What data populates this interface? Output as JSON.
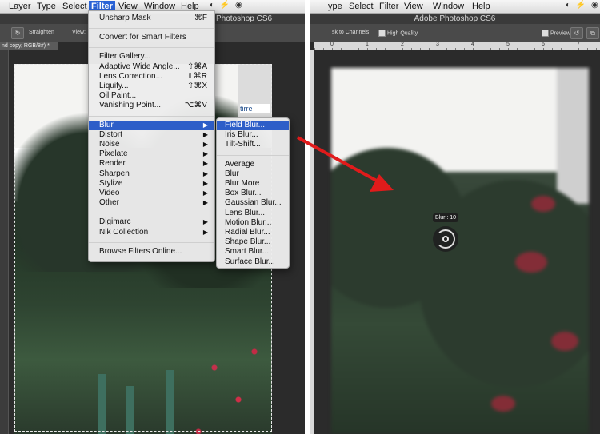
{
  "left": {
    "menubar": [
      "Layer",
      "Type",
      "Select",
      "Filter",
      "View",
      "Window",
      "Help"
    ],
    "active_menu": "Filter",
    "title": "Photoshop CS6",
    "options": {
      "straighten": "Straighten",
      "view": "View:"
    },
    "doc_tab": "nd copy, RGB/8#) *",
    "sign_text": "tirre"
  },
  "right": {
    "menubar": [
      "ype",
      "Select",
      "Filter",
      "View",
      "Window",
      "Help"
    ],
    "title": "Adobe Photoshop CS6",
    "options": {
      "channels": "sk to Channels",
      "high_quality": "High Quality",
      "preview": "Preview"
    },
    "ruler_ticks": [
      "0",
      "1",
      "2",
      "3",
      "4",
      "5",
      "6",
      "7"
    ],
    "blur_label": "Blur : 10"
  },
  "filter_menu": {
    "groups": [
      [
        {
          "label": "Unsharp Mask",
          "shortcut": "⌘F"
        }
      ],
      [
        {
          "label": "Convert for Smart Filters",
          "shortcut": ""
        }
      ],
      [
        {
          "label": "Filter Gallery...",
          "shortcut": ""
        },
        {
          "label": "Adaptive Wide Angle...",
          "shortcut": "⇧⌘A"
        },
        {
          "label": "Lens Correction...",
          "shortcut": "⇧⌘R"
        },
        {
          "label": "Liquify...",
          "shortcut": "⇧⌘X"
        },
        {
          "label": "Oil Paint...",
          "shortcut": ""
        },
        {
          "label": "Vanishing Point...",
          "shortcut": "⌥⌘V"
        }
      ],
      [
        {
          "label": "Blur",
          "submenu": true,
          "highlighted": true
        },
        {
          "label": "Distort",
          "submenu": true
        },
        {
          "label": "Noise",
          "submenu": true
        },
        {
          "label": "Pixelate",
          "submenu": true
        },
        {
          "label": "Render",
          "submenu": true
        },
        {
          "label": "Sharpen",
          "submenu": true
        },
        {
          "label": "Stylize",
          "submenu": true
        },
        {
          "label": "Video",
          "submenu": true
        },
        {
          "label": "Other",
          "submenu": true
        }
      ],
      [
        {
          "label": "Digimarc",
          "submenu": true
        },
        {
          "label": "Nik Collection",
          "submenu": true
        }
      ],
      [
        {
          "label": "Browse Filters Online...",
          "shortcut": ""
        }
      ]
    ]
  },
  "blur_submenu": {
    "groups": [
      [
        {
          "label": "Field Blur...",
          "highlighted": true
        },
        {
          "label": "Iris Blur..."
        },
        {
          "label": "Tilt-Shift..."
        }
      ],
      [
        {
          "label": "Average"
        },
        {
          "label": "Blur"
        },
        {
          "label": "Blur More"
        },
        {
          "label": "Box Blur..."
        },
        {
          "label": "Gaussian Blur..."
        },
        {
          "label": "Lens Blur..."
        },
        {
          "label": "Motion Blur..."
        },
        {
          "label": "Radial Blur..."
        },
        {
          "label": "Shape Blur..."
        },
        {
          "label": "Smart Blur..."
        },
        {
          "label": "Surface Blur..."
        }
      ]
    ]
  },
  "colors": {
    "highlight": "#2d5ec8",
    "arrow": "#e01b1b",
    "menubar_active": "#2a63d6"
  }
}
